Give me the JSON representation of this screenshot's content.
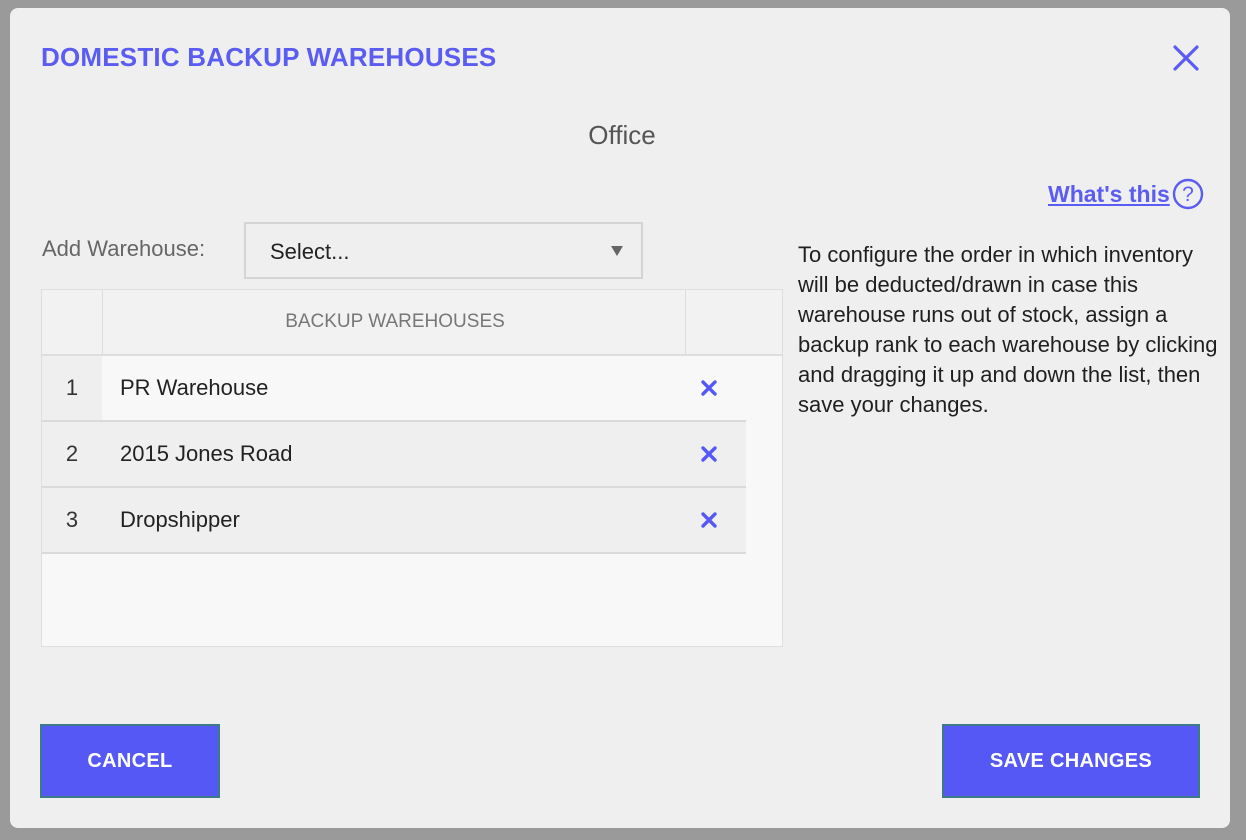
{
  "dialog": {
    "title": "DOMESTIC BACKUP WAREHOUSES",
    "close_icon": "close-icon",
    "subtitle": "Office"
  },
  "help": {
    "link_label": "What's this",
    "icon": "question-circle-icon"
  },
  "add_warehouse": {
    "label": "Add Warehouse:",
    "selected_value": "Select..."
  },
  "table": {
    "column_header": "BACKUP WAREHOUSES",
    "rows": [
      {
        "rank": "1",
        "name": "PR Warehouse"
      },
      {
        "rank": "2",
        "name": "2015 Jones Road"
      },
      {
        "rank": "3",
        "name": "Dropshipper"
      }
    ]
  },
  "instructions": "To configure the order in which inventory will be deducted/drawn in case this warehouse runs out of stock, assign a backup rank to each warehouse by clicking and dragging it up and down the list, then save your changes.",
  "footer": {
    "cancel_label": "CANCEL",
    "save_label": "SAVE CHANGES"
  },
  "colors": {
    "accent": "#5a5cf2",
    "button": "#5558f5",
    "background": "#efefef"
  }
}
